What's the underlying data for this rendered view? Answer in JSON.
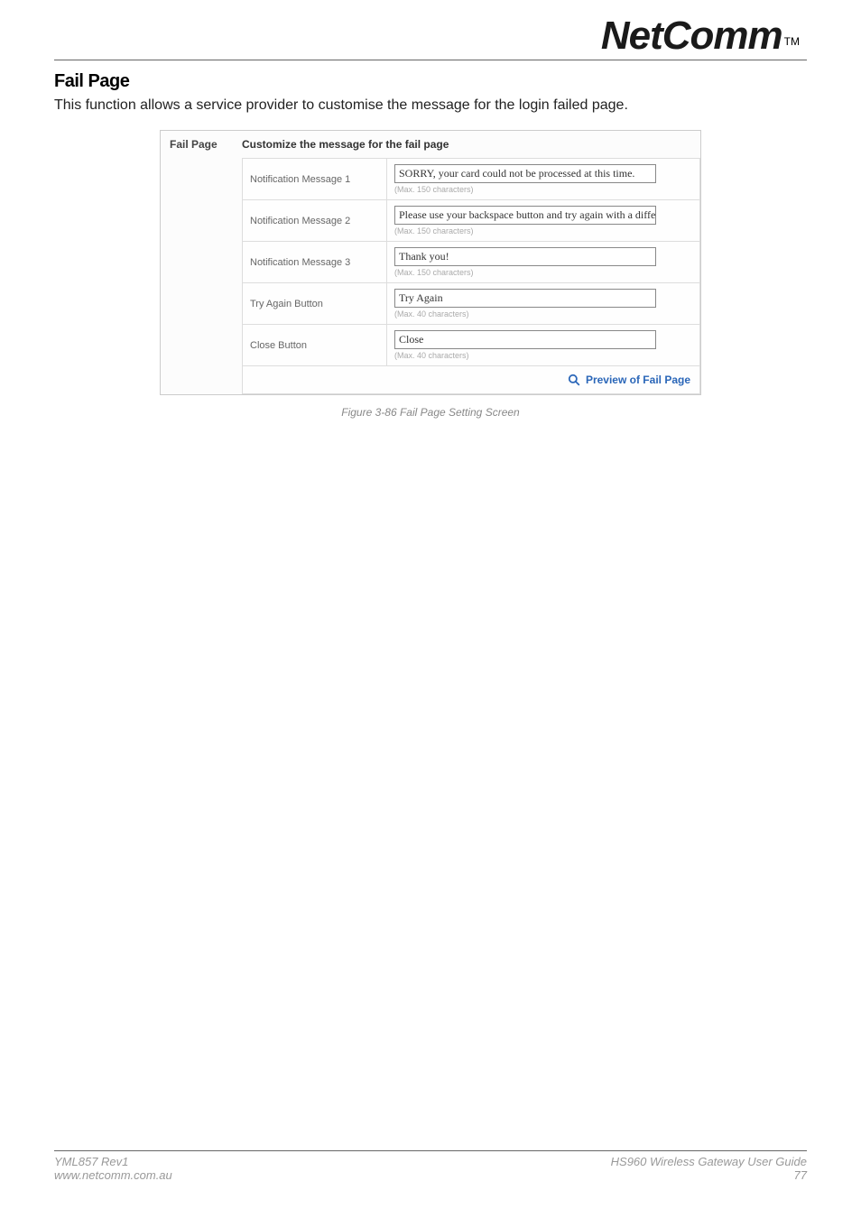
{
  "logo": {
    "brand": "NetComm",
    "tm": "TM"
  },
  "section": {
    "title": "Fail Page",
    "intro": "This function allows a service provider to customise the message for the login failed page."
  },
  "panel": {
    "side_label": "Fail Page",
    "header": "Customize the message for the fail page",
    "rows": [
      {
        "label": "Notification Message 1",
        "value": "SORRY, your card could not be processed at this time.",
        "hint": "(Max. 150 characters)"
      },
      {
        "label": "Notification Message 2",
        "value": "Please use your backspace button and try again with a different card",
        "hint": "(Max. 150 characters)"
      },
      {
        "label": "Notification Message 3",
        "value": "Thank you!",
        "hint": "(Max. 150 characters)"
      },
      {
        "label": "Try Again Button",
        "value": "Try Again",
        "hint": "(Max. 40 characters)"
      },
      {
        "label": "Close Button",
        "value": "Close",
        "hint": "(Max. 40 characters)"
      }
    ],
    "preview_label": "Preview of Fail Page"
  },
  "caption": "Figure 3-86 Fail Page Setting Screen",
  "footer": {
    "left_top": "YML857 Rev1",
    "left_bottom": "www.netcomm.com.au",
    "right_top": "HS960 Wireless Gateway User Guide",
    "right_bottom": "77"
  }
}
